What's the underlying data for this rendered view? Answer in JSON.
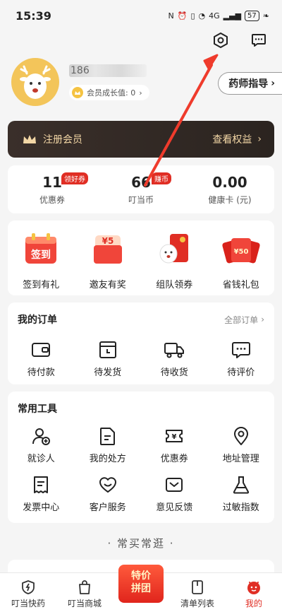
{
  "status": {
    "time": "15:39",
    "network": "4G",
    "battery": "57"
  },
  "profile": {
    "username": "186",
    "growth_label": "会员成长值: 0",
    "pharmacist_label": "药师指导"
  },
  "member": {
    "register_label": "注册会员",
    "benefits_label": "查看权益"
  },
  "stats": [
    {
      "value": "11",
      "label": "优惠券",
      "badge": "领好券"
    },
    {
      "value": "66",
      "label": "叮当币",
      "badge": "赚币"
    },
    {
      "value": "0.00",
      "label": "健康卡 (元)",
      "badge": ""
    }
  ],
  "promo": [
    {
      "label": "签到有礼",
      "art": "签到"
    },
    {
      "label": "邀友有奖",
      "art": "¥5"
    },
    {
      "label": "组队领券",
      "art": ""
    },
    {
      "label": "省钱礼包",
      "art": "¥50"
    }
  ],
  "orders": {
    "title": "我的订单",
    "all_label": "全部订单",
    "items": [
      {
        "label": "待付款",
        "icon": "wallet-icon"
      },
      {
        "label": "待发货",
        "icon": "box-clock-icon"
      },
      {
        "label": "待收货",
        "icon": "truck-icon"
      },
      {
        "label": "待评价",
        "icon": "chat-icon"
      }
    ]
  },
  "tools": {
    "title": "常用工具",
    "items": [
      {
        "label": "就诊人",
        "icon": "person-add-icon"
      },
      {
        "label": "我的处方",
        "icon": "document-icon"
      },
      {
        "label": "优惠券",
        "icon": "coupon-icon"
      },
      {
        "label": "地址管理",
        "icon": "location-icon"
      },
      {
        "label": "发票中心",
        "icon": "invoice-icon"
      },
      {
        "label": "客户服务",
        "icon": "heart-icon"
      },
      {
        "label": "意见反馈",
        "icon": "mail-icon"
      },
      {
        "label": "过敏指数",
        "icon": "flask-icon"
      }
    ]
  },
  "section_divider": "· 常买常逛 ·",
  "tabs": [
    {
      "label": "叮当快药"
    },
    {
      "label": "叮当商城"
    },
    {
      "label": "特价\n拼团"
    },
    {
      "label": "清单列表"
    },
    {
      "label": "我的"
    }
  ],
  "colors": {
    "accent": "#e02e24",
    "member_gold": "#f3d7a6",
    "member_bg": "#2b2420"
  }
}
